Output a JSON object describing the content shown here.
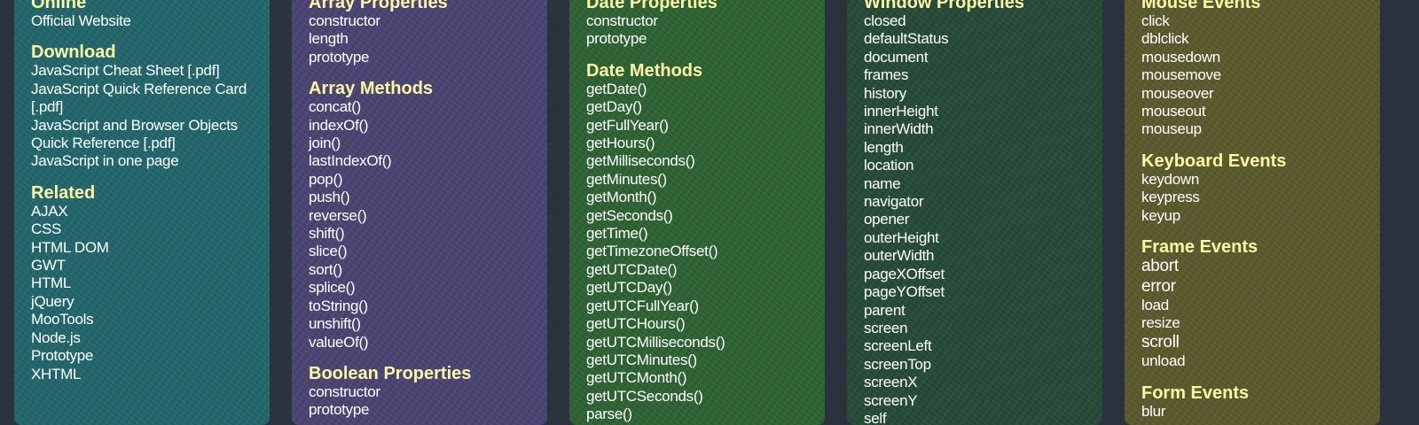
{
  "colors": {
    "page_background": "#2a323d",
    "heading": "#fdf7a6",
    "link": "#ffffff"
  },
  "columns": [
    {
      "id": "col-1",
      "background": "#22666c",
      "sections": [
        {
          "title": "Online",
          "items": [
            "Official Website"
          ]
        },
        {
          "title": "Download",
          "items": [
            "JavaScript Cheat Sheet [.pdf]",
            "JavaScript Quick Reference Card [.pdf]",
            "JavaScript and Browser Objects Quick Reference [.pdf]",
            "JavaScript in one page"
          ]
        },
        {
          "title": "Related",
          "items": [
            "AJAX",
            "CSS",
            "HTML DOM",
            "GWT",
            "HTML",
            "jQuery",
            "MooTools",
            "Node.js",
            "Prototype",
            "XHTML"
          ]
        }
      ]
    },
    {
      "id": "col-2",
      "background": "#4a4473",
      "sections": [
        {
          "title": "Array Properties",
          "items": [
            "constructor",
            "length",
            "prototype"
          ]
        },
        {
          "title": "Array Methods",
          "items": [
            "concat()",
            "indexOf()",
            "join()",
            "lastIndexOf()",
            "pop()",
            "push()",
            "reverse()",
            "shift()",
            "slice()",
            "sort()",
            "splice()",
            "toString()",
            "unshift()",
            "valueOf()"
          ]
        },
        {
          "title": "Boolean Properties",
          "items": [
            "constructor",
            "prototype"
          ]
        }
      ]
    },
    {
      "id": "col-3",
      "background": "#2d6232",
      "sections": [
        {
          "title": "Date Properties",
          "items": [
            "constructor",
            "prototype"
          ]
        },
        {
          "title": "Date Methods",
          "items": [
            "getDate()",
            "getDay()",
            "getFullYear()",
            "getHours()",
            "getMilliseconds()",
            "getMinutes()",
            "getMonth()",
            "getSeconds()",
            "getTime()",
            "getTimezoneOffset()",
            "getUTCDate()",
            "getUTCDay()",
            "getUTCFullYear()",
            "getUTCHours()",
            "getUTCMilliseconds()",
            "getUTCMinutes()",
            "getUTCMonth()",
            "getUTCSeconds()",
            "parse()"
          ]
        }
      ]
    },
    {
      "id": "col-4",
      "background": "#264a38",
      "sections": [
        {
          "title": "Window Properties",
          "items": [
            "closed",
            "defaultStatus",
            "document",
            "frames",
            "history",
            "innerHeight",
            "innerWidth",
            "length",
            "location",
            "name",
            "navigator",
            "opener",
            "outerHeight",
            "outerWidth",
            "pageXOffset",
            "pageYOffset",
            "parent",
            "screen",
            "screenLeft",
            "screenTop",
            "screenX",
            "screenY",
            "self"
          ]
        }
      ]
    },
    {
      "id": "col-5",
      "background": "#5b5a2d",
      "sections": [
        {
          "title": "Mouse Events",
          "items": [
            "click",
            "dblclick",
            "mousedown",
            "mousemove",
            "mouseover",
            "mouseout",
            "mouseup"
          ]
        },
        {
          "title": "Keyboard Events",
          "items": [
            "keydown",
            "keypress",
            "keyup"
          ]
        },
        {
          "title": "Frame Events",
          "items": [
            "abort",
            "error",
            "load",
            "resize",
            "scroll",
            "unload"
          ],
          "big_items": [
            "abort",
            "error",
            "scroll"
          ]
        },
        {
          "title": "Form Events",
          "items": [
            "blur"
          ]
        }
      ]
    }
  ]
}
